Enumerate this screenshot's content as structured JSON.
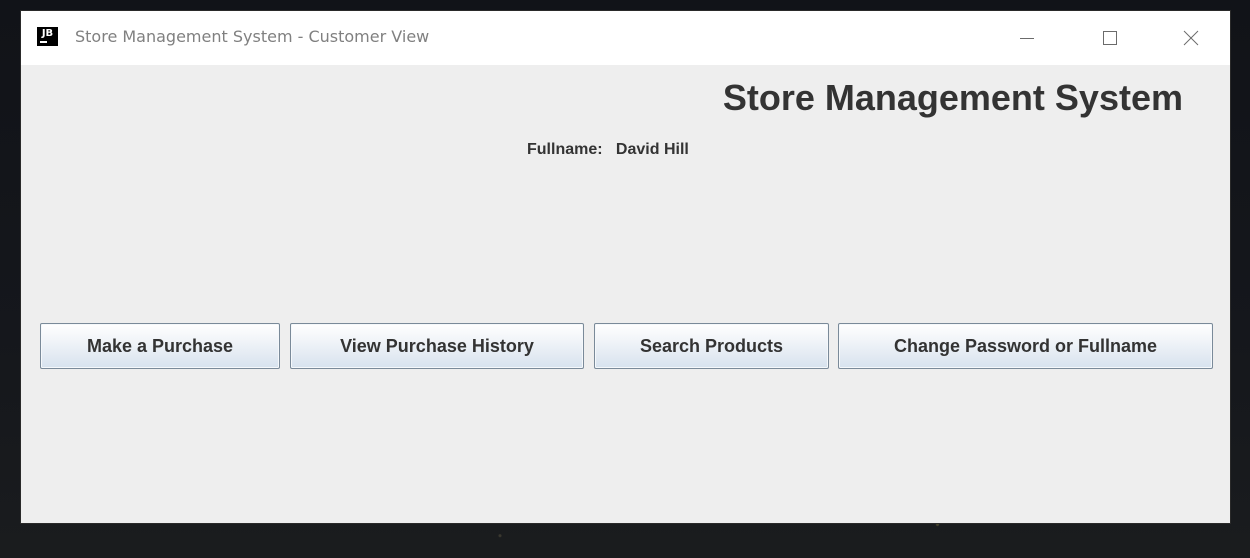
{
  "window": {
    "title": "Store Management System - Customer View",
    "icon_label": "JB"
  },
  "main": {
    "heading": "Store Management System",
    "fullname_label": "Fullname:",
    "fullname_value": "David Hill"
  },
  "buttons": {
    "make_purchase": "Make a Purchase",
    "view_history": "View Purchase History",
    "search_products": "Search Products",
    "change_account": "Change Password or Fullname"
  },
  "icons": {
    "minimize": "minimize-icon",
    "maximize": "maximize-icon",
    "close": "close-icon"
  },
  "colors": {
    "window_bg": "#eeeeee",
    "titlebar_bg": "#ffffff",
    "text": "#333333",
    "button_border": "#7a8a99"
  }
}
